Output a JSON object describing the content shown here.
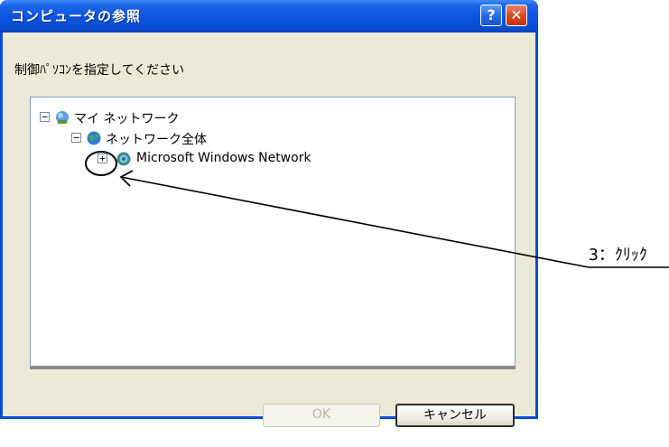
{
  "dialog": {
    "title": "コンピュータの参照",
    "help_label": "?",
    "close_label": "✕",
    "instruction": "制御ﾊﾟｿｺﾝを指定してください",
    "tree": [
      {
        "expander": "−",
        "label": "マイ ネットワーク",
        "icon": "network-places-icon"
      },
      {
        "expander": "−",
        "label": "ネットワーク全体",
        "icon": "globe-icon"
      },
      {
        "expander": "+",
        "label": "Microsoft Windows Network",
        "icon": "windows-network-icon"
      }
    ],
    "ok_label": "OK",
    "cancel_label": "キャンセル"
  },
  "annotation": {
    "label": "3：ｸﾘｯｸ"
  },
  "colors": {
    "titlebar": "#0B55E2",
    "dialog_bg": "#ECE9D8",
    "close_button": "#D8461F",
    "tree_border": "#7F9DB9"
  }
}
